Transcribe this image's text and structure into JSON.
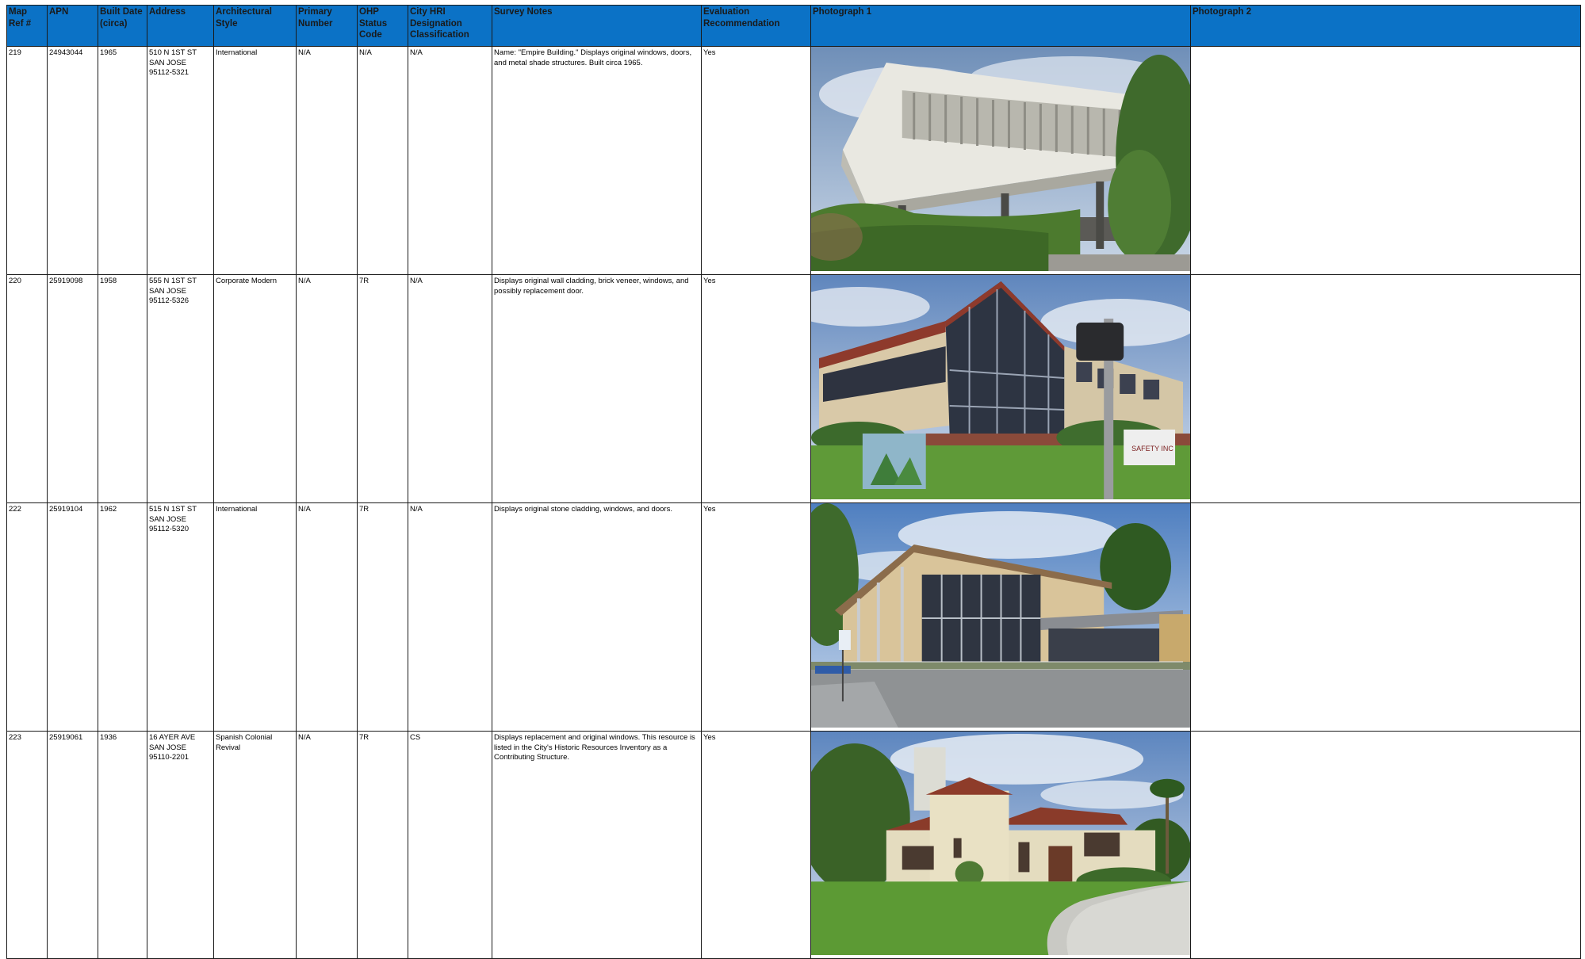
{
  "table": {
    "headers": [
      "Map\nRef #",
      "APN",
      "Built Date\n(circa)",
      "Address",
      "Architectural\nStyle",
      "Primary\nNumber",
      "OHP\nStatus\nCode",
      "City HRI\nDesignation\nClassification",
      "Survey Notes",
      "Evaluation\nRecommendation",
      "Photograph 1",
      "Photograph 2"
    ],
    "rows": [
      {
        "map_ref": "219",
        "apn": "24943044",
        "built": "1965",
        "address": "510 N 1ST ST\nSAN JOSE\n95112-5321",
        "style": "International",
        "primary_number": "N/A",
        "ohp_status": "N/A",
        "hri": "N/A",
        "notes": "Name: \"Empire Building.\" Displays original windows, doors, and metal shade structures. Built circa 1965.",
        "evaluation": "Yes",
        "photo1": "photo-modern-building-overhang",
        "photo2": ""
      },
      {
        "map_ref": "220",
        "apn": "25919098",
        "built": "1958",
        "address": "555 N 1ST ST\nSAN JOSE\n95112-5326",
        "style": "Corporate Modern",
        "primary_number": "N/A",
        "ohp_status": "7R",
        "hri": "N/A",
        "notes": "Displays original wall cladding, brick veneer, windows, and possibly replacement door.",
        "evaluation": "Yes",
        "photo1": "photo-glass-corner-building",
        "photo2": ""
      },
      {
        "map_ref": "222",
        "apn": "25919104",
        "built": "1962",
        "address": "515 N 1ST ST\nSAN JOSE\n95112-5320",
        "style": "International",
        "primary_number": "N/A",
        "ohp_status": "7R",
        "hri": "N/A",
        "notes": "Displays original stone cladding, windows, and doors.",
        "evaluation": "Yes",
        "photo1": "photo-office-building-parking",
        "photo2": ""
      },
      {
        "map_ref": "223",
        "apn": "25919061",
        "built": "1936",
        "address": "16 AYER AVE\nSAN JOSE\n95110-2201",
        "style": "Spanish Colonial\nRevival",
        "primary_number": "N/A",
        "ohp_status": "7R",
        "hri": "CS",
        "notes": "Displays replacement and original windows. This resource is listed in the City's Historic Resources Inventory as a Contributing Structure.",
        "evaluation": "Yes",
        "photo1": "photo-spanish-house-lawn",
        "photo2": ""
      }
    ]
  },
  "colors": {
    "header_background": "#0b72c6",
    "header_text": "#1a1a1a",
    "border": "#1a1a1a"
  }
}
